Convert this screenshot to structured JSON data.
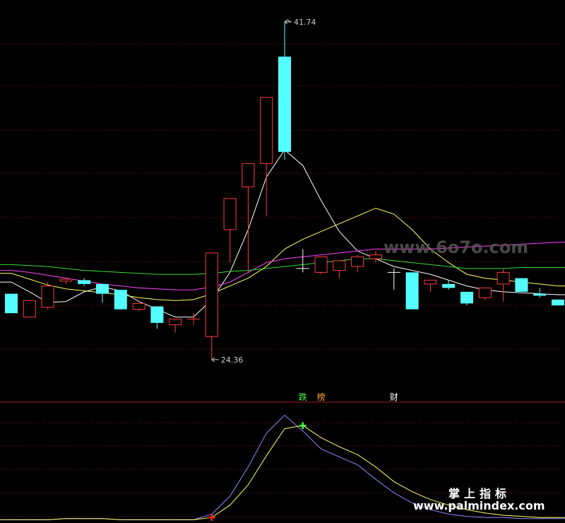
{
  "chart_data": [
    {
      "type": "candlestick",
      "title": "",
      "ylim": [
        22.5,
        42.5
      ],
      "price_high_label": "41.74",
      "price_low_label": "24.36",
      "candles": [
        {
          "open": 27.75,
          "high": 27.75,
          "low": 26.75,
          "close": 26.75,
          "dir": "down"
        },
        {
          "open": 26.55,
          "high": 27.4,
          "low": 26.55,
          "close": 27.4,
          "dir": "up"
        },
        {
          "open": 27.05,
          "high": 28.35,
          "low": 26.95,
          "close": 28.15,
          "dir": "up"
        },
        {
          "open": 28.4,
          "high": 28.5,
          "low": 28.25,
          "close": 28.5,
          "dir": "up"
        },
        {
          "open": 28.45,
          "high": 28.55,
          "low": 28.15,
          "close": 28.25,
          "dir": "down"
        },
        {
          "open": 28.25,
          "high": 28.25,
          "low": 27.3,
          "close": 27.75,
          "dir": "down"
        },
        {
          "open": 27.95,
          "high": 27.95,
          "low": 26.95,
          "close": 26.95,
          "dir": "down"
        },
        {
          "open": 26.95,
          "high": 27.25,
          "low": 26.85,
          "close": 27.25,
          "dir": "up"
        },
        {
          "open": 27.1,
          "high": 27.1,
          "low": 25.95,
          "close": 26.25,
          "dir": "down"
        },
        {
          "open": 26.15,
          "high": 26.45,
          "low": 25.75,
          "close": 26.45,
          "dir": "up"
        },
        {
          "open": 26.45,
          "high": 26.75,
          "low": 26.15,
          "close": 26.45,
          "dir": "up"
        },
        {
          "open": 25.55,
          "high": 29.85,
          "low": 24.36,
          "close": 29.85,
          "dir": "up"
        },
        {
          "open": 31.05,
          "high": 31.05,
          "low": 29.35,
          "close": 32.65,
          "dir": "up"
        },
        {
          "open": 33.25,
          "high": 33.25,
          "low": 28.85,
          "close": 34.45,
          "dir": "up"
        },
        {
          "open": 34.45,
          "high": 34.45,
          "low": 31.75,
          "close": 37.85,
          "dir": "up"
        },
        {
          "open": 39.95,
          "high": 41.74,
          "low": 34.65,
          "close": 35.05,
          "dir": "down"
        },
        {
          "open": 29.05,
          "high": 30.05,
          "low": 28.85,
          "close": 29.05,
          "dir": "flat"
        },
        {
          "open": 28.85,
          "high": 29.45,
          "low": 28.75,
          "close": 29.65,
          "dir": "up"
        },
        {
          "open": 28.95,
          "high": 28.95,
          "low": 28.55,
          "close": 29.45,
          "dir": "up"
        },
        {
          "open": 29.15,
          "high": 29.75,
          "low": 28.85,
          "close": 29.65,
          "dir": "up"
        },
        {
          "open": 29.55,
          "high": 29.95,
          "low": 29.35,
          "close": 29.75,
          "dir": "up"
        },
        {
          "open": 28.85,
          "high": 29.05,
          "low": 27.95,
          "close": 28.85,
          "dir": "flat"
        },
        {
          "open": 28.85,
          "high": 28.85,
          "low": 26.95,
          "close": 26.95,
          "dir": "down"
        },
        {
          "open": 28.25,
          "high": 28.45,
          "low": 27.85,
          "close": 28.45,
          "dir": "up"
        },
        {
          "open": 28.25,
          "high": 28.45,
          "low": 27.95,
          "close": 28.05,
          "dir": "down"
        },
        {
          "open": 27.85,
          "high": 27.85,
          "low": 27.15,
          "close": 27.25,
          "dir": "down"
        },
        {
          "open": 27.55,
          "high": 28.05,
          "low": 27.45,
          "close": 28.05,
          "dir": "up"
        },
        {
          "open": 28.25,
          "high": 29.05,
          "low": 27.35,
          "close": 28.85,
          "dir": "up"
        },
        {
          "open": 28.55,
          "high": 28.55,
          "low": 27.85,
          "close": 27.85,
          "dir": "down"
        },
        {
          "open": 27.75,
          "high": 28.05,
          "low": 27.55,
          "close": 27.65,
          "dir": "down"
        },
        {
          "open": 27.45,
          "high": 27.45,
          "low": 27.15,
          "close": 27.15,
          "dir": "down"
        }
      ],
      "series": [
        {
          "color": "#ffffff",
          "values": [
            28.35,
            27.85,
            27.3,
            27.35,
            27.85,
            28.1,
            27.9,
            27.35,
            26.95,
            26.55,
            26.55,
            27.45,
            28.85,
            31.05,
            33.75,
            35.15,
            34.35,
            32.55,
            30.95,
            29.95,
            29.55,
            29.15,
            28.95,
            28.75,
            28.45,
            28.15,
            27.95,
            27.85,
            27.8,
            27.75,
            27.7
          ]
        },
        {
          "color": "#ffff66",
          "values": [
            28.8,
            28.5,
            28.2,
            28.0,
            27.9,
            27.8,
            27.7,
            27.55,
            27.45,
            27.4,
            27.45,
            27.75,
            28.15,
            28.55,
            29.15,
            30.05,
            30.55,
            30.95,
            31.35,
            31.75,
            32.15,
            31.85,
            31.05,
            30.05,
            29.35,
            28.75,
            28.55,
            28.45,
            28.35,
            28.25,
            28.15
          ]
        },
        {
          "color": "#ff44ff",
          "values": [
            28.95,
            28.85,
            28.7,
            28.55,
            28.4,
            28.25,
            28.15,
            28.05,
            28.0,
            27.95,
            27.95,
            28.1,
            28.35,
            28.85,
            29.35,
            29.55,
            29.65,
            29.75,
            29.85,
            29.95,
            30.05,
            30.05,
            30.05,
            30.05,
            30.1,
            30.15,
            30.2,
            30.25,
            30.3,
            30.35,
            30.4
          ]
        },
        {
          "color": "#33dd33",
          "values": [
            29.25,
            29.2,
            29.15,
            29.05,
            28.95,
            28.9,
            28.85,
            28.8,
            28.75,
            28.75,
            28.75,
            28.8,
            28.9,
            28.95,
            29.05,
            29.15,
            29.25,
            29.35,
            29.45,
            29.55,
            29.55,
            29.45,
            29.35,
            29.25,
            29.15,
            29.05,
            29.05,
            29.05,
            29.1,
            29.1,
            29.1
          ]
        }
      ],
      "markers": [
        {
          "text": "跌",
          "index": 16,
          "color": "#44ff44"
        },
        {
          "text": "榜",
          "index": 17,
          "color": "#ffaa33"
        },
        {
          "text": "财",
          "index": 21,
          "color": "#ffffff"
        }
      ],
      "grid": true
    },
    {
      "type": "line",
      "title": "",
      "ylim": [
        0,
        100
      ],
      "series": [
        {
          "color": "#8888ff",
          "values": [
            1,
            1,
            1,
            2,
            2,
            2,
            1,
            1,
            1,
            1,
            1,
            6,
            22,
            48,
            78,
            94,
            80,
            64,
            57,
            50,
            37,
            25,
            16,
            10,
            6,
            4,
            3,
            3,
            2,
            2,
            2
          ]
        },
        {
          "color": "#ffff66",
          "values": [
            1,
            1,
            1,
            2,
            2,
            2,
            1,
            1,
            1,
            1,
            1,
            3,
            14,
            32,
            58,
            82,
            85,
            74,
            66,
            59,
            48,
            35,
            26,
            19,
            14,
            10,
            7,
            5,
            4,
            3,
            3
          ]
        }
      ],
      "markers": [
        {
          "symbol": "✚",
          "index": 16,
          "color": "#44ff44"
        },
        {
          "symbol": "✚",
          "index": 11,
          "color": "#ff2222"
        }
      ],
      "grid": true
    }
  ],
  "watermarks": {
    "top": "www.6o7o.com",
    "bottom_cn": "掌上指标",
    "bottom_url": "www.palmindex.com"
  }
}
